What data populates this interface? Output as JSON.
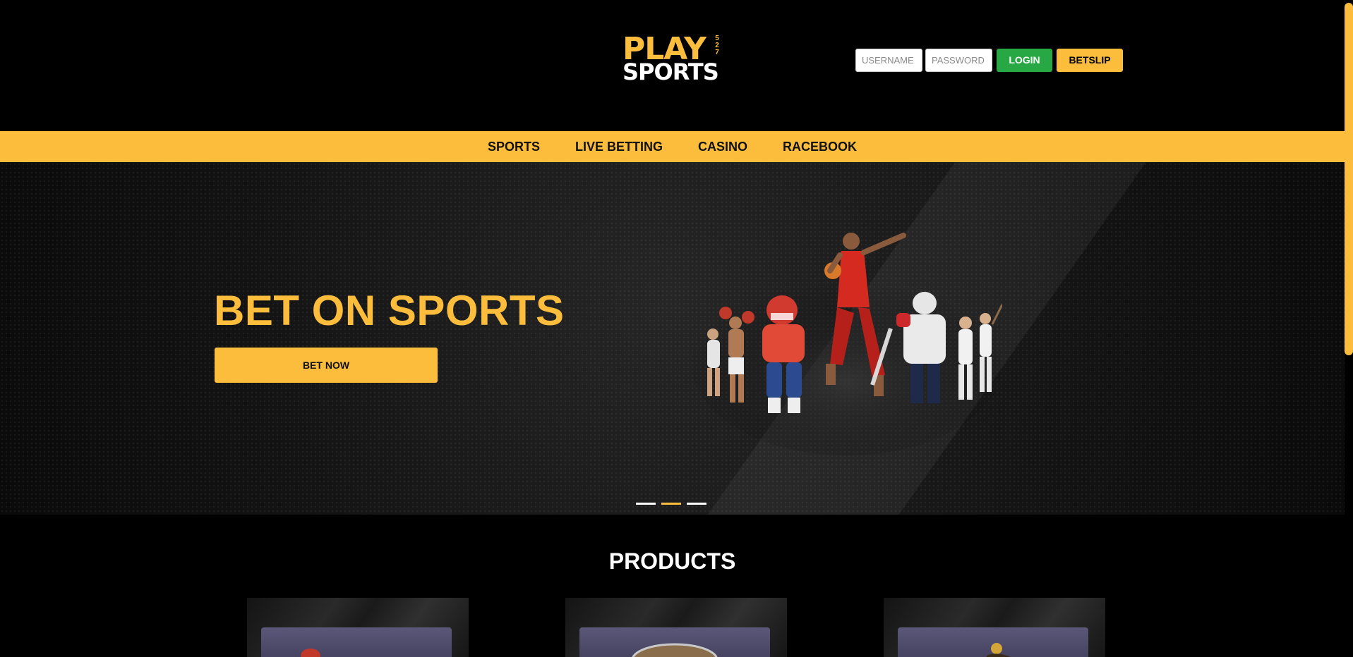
{
  "brand": {
    "play": "PLAY",
    "sports": "SPORTS",
    "number": "527"
  },
  "login": {
    "username_placeholder": "USERNAME",
    "password_placeholder": "PASSWORD",
    "login_label": "LOGIN",
    "betslip_label": "BETSLIP"
  },
  "nav": {
    "items": [
      {
        "label": "SPORTS"
      },
      {
        "label": "LIVE BETTING"
      },
      {
        "label": "CASINO"
      },
      {
        "label": "RACEBOOK"
      }
    ]
  },
  "hero": {
    "title": "BET ON SPORTS",
    "cta_label": "BET NOW",
    "slides": 3,
    "active_slide": 2
  },
  "products": {
    "title": "PRODUCTS",
    "cards": [
      {
        "icon": "sports-ball-icon"
      },
      {
        "icon": "casino-roulette-icon"
      },
      {
        "icon": "horse-racing-icon"
      }
    ]
  },
  "colors": {
    "accent": "#fbbd3b",
    "login_green": "#28a745",
    "background": "#000000"
  }
}
